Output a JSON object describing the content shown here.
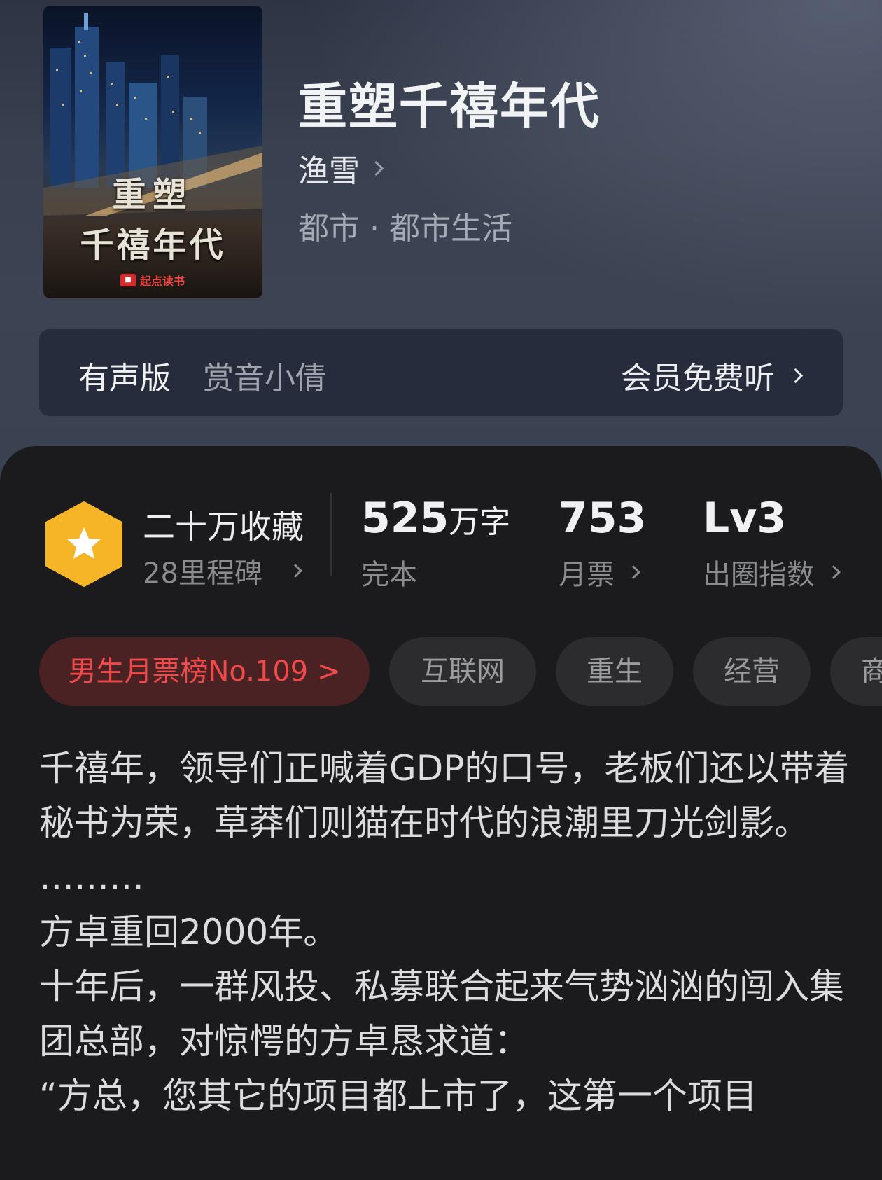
{
  "book": {
    "title": "重塑千禧年代",
    "author": "渔雪",
    "genre": "都市 · 都市生活",
    "cover_title_line1": "重塑",
    "cover_title_line2": "千禧年代",
    "cover_brand": "起点读书"
  },
  "audio": {
    "label": "有声版",
    "narrator": "赏音小倩",
    "cta": "会员免费听"
  },
  "stats": {
    "collect_main": "二十万收藏",
    "collect_sub": "28里程碑",
    "words_value": "525",
    "words_unit": "万字",
    "words_sub": "完本",
    "tickets_value": "753",
    "tickets_sub": "月票",
    "index_value": "Lv3",
    "index_sub": "出圈指数"
  },
  "tags": [
    "男生月票榜No.109 >",
    "互联网",
    "重生",
    "经营",
    "商"
  ],
  "synopsis": [
    "千禧年，领导们正喊着GDP的口号，老板们还以带着秘书为荣，草莽们则猫在时代的浪潮里刀光剑影。",
    "………",
    "方卓重回2000年。",
    "十年后，一群风投、私募联合起来气势汹汹的闯入集团总部，对惊愕的方卓恳求道：",
    "“方总，您其它的项目都上市了，这第一个项目"
  ],
  "colors": {
    "badge": "#f5b526",
    "rank_tag_text": "#f04a4a",
    "rank_tag_bg": "#4a2224"
  }
}
